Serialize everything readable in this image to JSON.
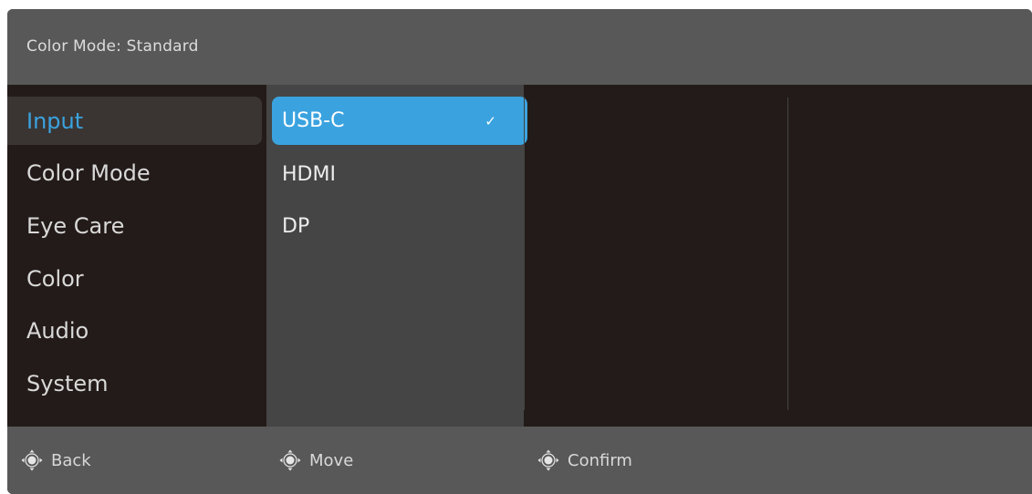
{
  "header": {
    "title": "Color Mode: Standard"
  },
  "main_menu": {
    "items": [
      {
        "label": "Input",
        "selected": true
      },
      {
        "label": "Color Mode",
        "selected": false
      },
      {
        "label": "Eye Care",
        "selected": false
      },
      {
        "label": "Color",
        "selected": false
      },
      {
        "label": "Audio",
        "selected": false
      },
      {
        "label": "System",
        "selected": false
      }
    ]
  },
  "submenu": {
    "options": [
      {
        "label": "USB-C",
        "active": true,
        "check": "✓"
      },
      {
        "label": "HDMI",
        "active": false
      },
      {
        "label": "DP",
        "active": false
      }
    ]
  },
  "footer": {
    "hints": [
      {
        "icon": "joystick-icon",
        "label": "Back"
      },
      {
        "icon": "joystick-icon",
        "label": "Move"
      },
      {
        "icon": "joystick-icon",
        "label": "Confirm"
      }
    ]
  },
  "colors": {
    "accent": "#3aa3df",
    "panel_bg": "#231b19",
    "bar_bg": "#585858",
    "submenu_bg": "#454545"
  }
}
